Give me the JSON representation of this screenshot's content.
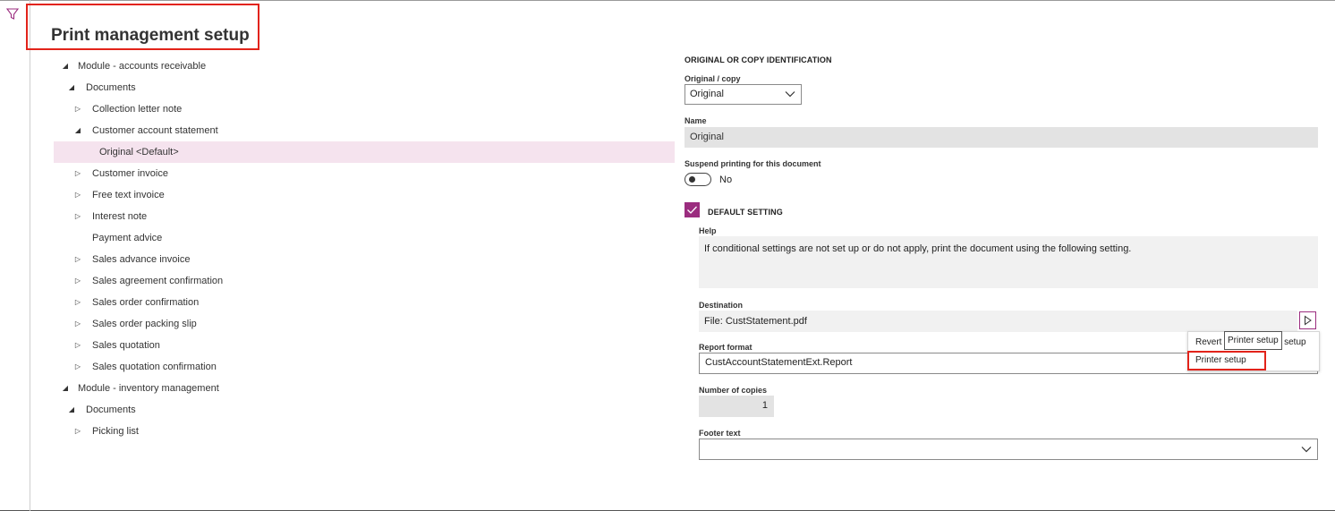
{
  "page": {
    "title": "Print management setup"
  },
  "tree": [
    {
      "label": "Module - accounts receivable",
      "expander": "expanded",
      "level": 0
    },
    {
      "label": "Documents",
      "expander": "expanded",
      "level": 1
    },
    {
      "label": "Collection letter note",
      "expander": "collapsed",
      "level": 2
    },
    {
      "label": "Customer account statement",
      "expander": "expanded",
      "level": 2
    },
    {
      "label": "Original <Default>",
      "expander": "none",
      "level": 3,
      "selected": true
    },
    {
      "label": "Customer invoice",
      "expander": "collapsed",
      "level": 2
    },
    {
      "label": "Free text invoice",
      "expander": "collapsed",
      "level": 2
    },
    {
      "label": "Interest note",
      "expander": "collapsed",
      "level": 2
    },
    {
      "label": "Payment advice",
      "expander": "none",
      "level": 2
    },
    {
      "label": "Sales advance invoice",
      "expander": "collapsed",
      "level": 2
    },
    {
      "label": "Sales agreement confirmation",
      "expander": "collapsed",
      "level": 2
    },
    {
      "label": "Sales order confirmation",
      "expander": "collapsed",
      "level": 2
    },
    {
      "label": "Sales order packing slip",
      "expander": "collapsed",
      "level": 2
    },
    {
      "label": "Sales quotation",
      "expander": "collapsed",
      "level": 2
    },
    {
      "label": "Sales quotation confirmation",
      "expander": "collapsed",
      "level": 2
    },
    {
      "label": "Module - inventory management",
      "expander": "expanded",
      "level": 0
    },
    {
      "label": "Documents",
      "expander": "expanded",
      "level": 1
    },
    {
      "label": "Picking list",
      "expander": "collapsed",
      "level": 2
    }
  ],
  "form": {
    "section_title": "ORIGINAL OR COPY IDENTIFICATION",
    "original_copy": {
      "label": "Original / copy",
      "value": "Original"
    },
    "name": {
      "label": "Name",
      "value": "Original"
    },
    "suspend": {
      "label": "Suspend printing for this document",
      "value": "No",
      "on": false
    },
    "default_setting": {
      "label": "DEFAULT SETTING",
      "checked": true
    },
    "help": {
      "label": "Help",
      "text": "If conditional settings are not set up or do not apply, print the document using the following setting."
    },
    "destination": {
      "label": "Destination",
      "value": "File: CustStatement.pdf"
    },
    "report_format": {
      "label": "Report format",
      "value": "CustAccountStatementExt.Report"
    },
    "copies": {
      "label": "Number of copies",
      "value": "1"
    },
    "footer": {
      "label": "Footer text",
      "value": ""
    }
  },
  "dropdown_menu": {
    "item_revert_left": "Revert t",
    "item_revert_right": "r setup",
    "item_printer_setup": "Printer setup",
    "tooltip": "Printer setup"
  },
  "colors": {
    "accent": "#9b2d7f",
    "highlight": "#e2231a",
    "selected_row": "#f5e3ee"
  },
  "icons": [
    "filter-icon",
    "tree-expanded-icon",
    "tree-collapsed-icon",
    "chevron-down-icon",
    "checkmark-icon",
    "arrow-right-icon"
  ]
}
